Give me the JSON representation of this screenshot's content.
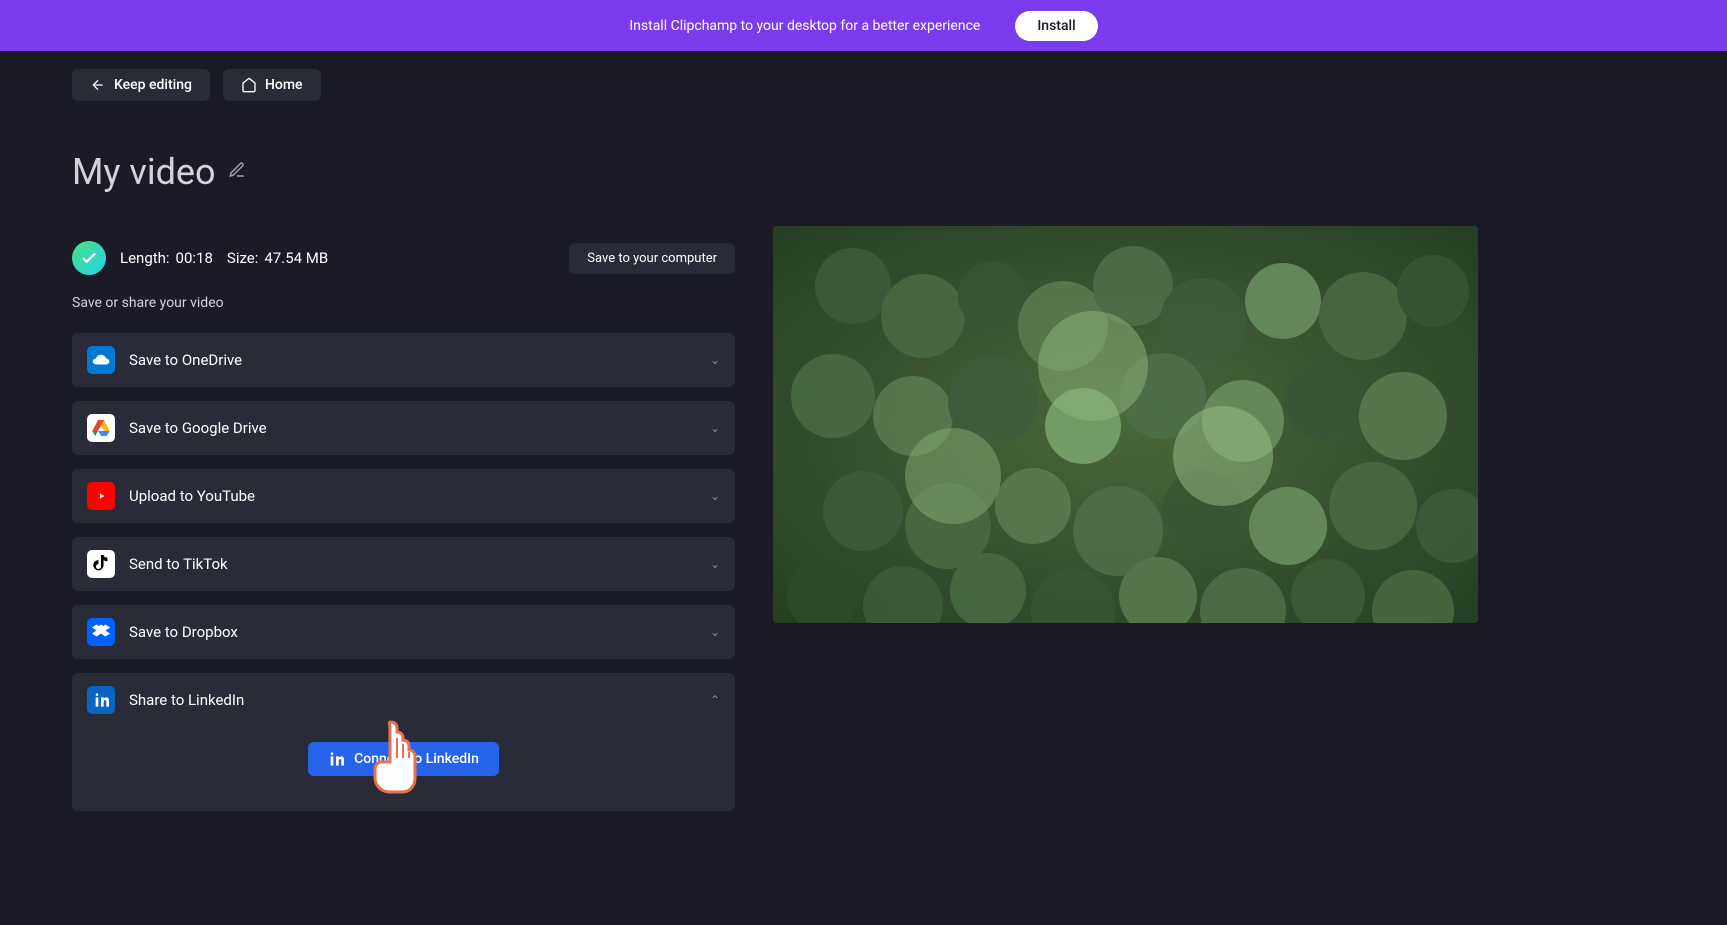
{
  "banner": {
    "text": "Install Clipchamp to your desktop for a better experience",
    "button": "Install"
  },
  "nav": {
    "keep_editing": "Keep editing",
    "home": "Home"
  },
  "title": "My video",
  "video_info": {
    "length_label": "Length:",
    "length_value": "00:18",
    "size_label": "Size:",
    "size_value": "47.54 MB"
  },
  "save_computer": "Save to your computer",
  "share_label": "Save or share your video",
  "share_options": {
    "onedrive": "Save to OneDrive",
    "gdrive": "Save to Google Drive",
    "youtube": "Upload to YouTube",
    "tiktok": "Send to TikTok",
    "dropbox": "Save to Dropbox",
    "linkedin": "Share to LinkedIn"
  },
  "connect_linkedin": "Connect to LinkedIn"
}
